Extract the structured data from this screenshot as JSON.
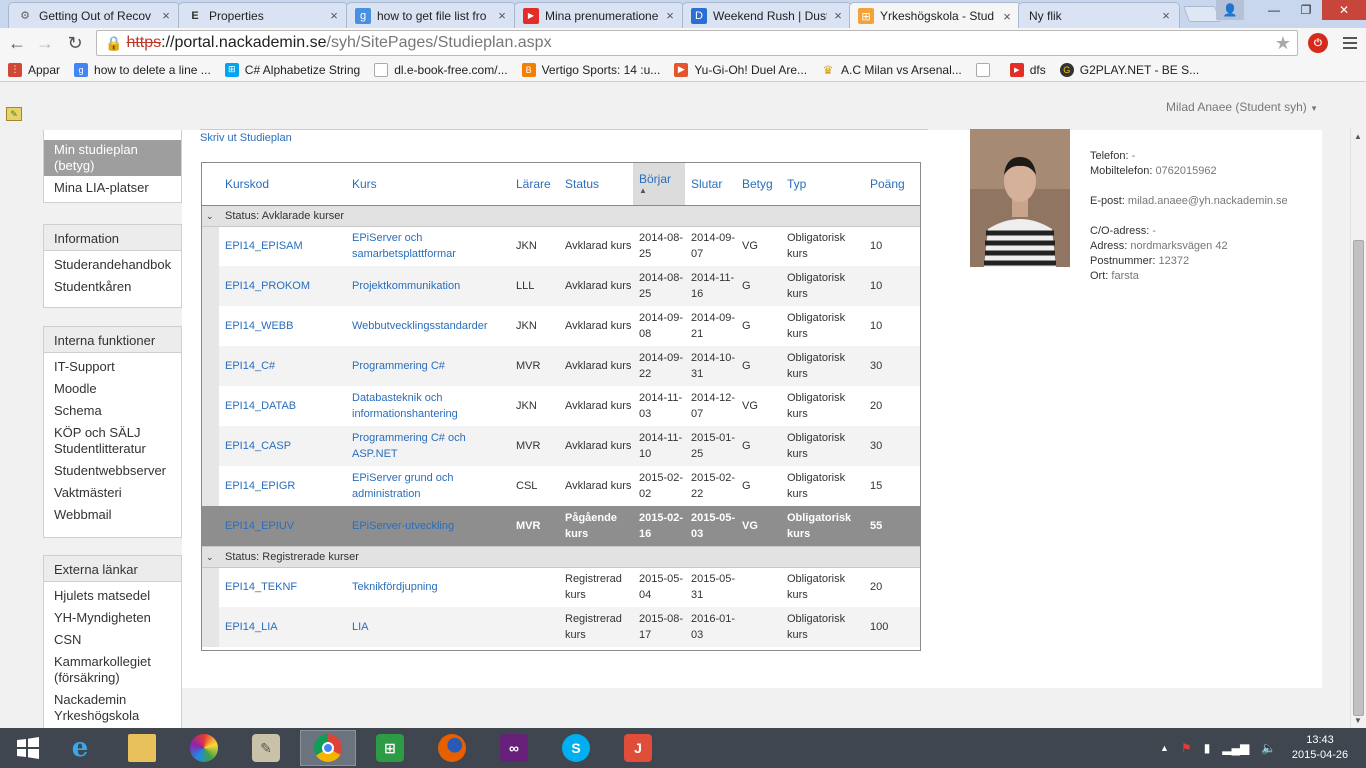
{
  "browser": {
    "tabs": [
      {
        "label": "Getting Out of Recov",
        "favicon": "gear-icon",
        "active": false
      },
      {
        "label": "Properties",
        "favicon": "edge-e-icon",
        "active": false
      },
      {
        "label": "how to get file list fro",
        "favicon": "google-icon",
        "active": false
      },
      {
        "label": "Mina prenumerationer",
        "favicon": "youtube-icon",
        "active": false
      },
      {
        "label": "Weekend Rush | Dust",
        "favicon": "dust-d-icon",
        "active": false
      },
      {
        "label": "Yrkeshögskola - Stud",
        "favicon": "yh-icon",
        "active": true
      },
      {
        "label": "Ny flik",
        "favicon": "",
        "active": false
      }
    ],
    "url": {
      "scheme": "https",
      "host": "://portal.nackademin.se",
      "path": "/syh/SitePages/Studieplan.aspx"
    },
    "bookmarks": [
      {
        "label": "Appar",
        "icon": "apps-icon",
        "color": "#d14836"
      },
      {
        "label": "how to delete a line ...",
        "icon": "google-icon",
        "color": "#4285f4"
      },
      {
        "label": "C# Alphabetize String",
        "icon": "windows-icon",
        "color": "#00a4ef"
      },
      {
        "label": "dl.e-book-free.com/...",
        "icon": "page-icon",
        "color": "#aaaaaa"
      },
      {
        "label": "Vertigo Sports: 14 :u...",
        "icon": "blogger-icon",
        "color": "#f57d00"
      },
      {
        "label": "Yu-Gi-Oh! Duel Are...",
        "icon": "play-icon",
        "color": "#e5552c"
      },
      {
        "label": "A.C Milan vs Arsenal...",
        "icon": "trophy-icon",
        "color": "#d4a20f"
      },
      {
        "label": "dfs",
        "icon": "youtube-icon",
        "color": "#e52d27"
      },
      {
        "label": "G2PLAY.NET - BE S...",
        "icon": "g2play-icon",
        "color": "#333333"
      }
    ]
  },
  "page": {
    "user_menu": "Milad Anaee (Student syh)",
    "print_link": "Skriv ut Studieplan"
  },
  "sidebar": {
    "top_items": [
      "Min studieplan (betyg)",
      "Mina LIA-platser"
    ],
    "sections": [
      {
        "title": "Information",
        "items": [
          "Studerandehandbok",
          "Studentkåren"
        ]
      },
      {
        "title": "Interna funktioner",
        "items": [
          "IT-Support",
          "Moodle",
          "Schema",
          "KÖP och SÄLJ Studentlitteratur",
          "Studentwebbserver",
          "Vaktmästeri",
          "Webbmail"
        ]
      },
      {
        "title": "Externa länkar",
        "items": [
          "Hjulets matsedel",
          "YH-Myndigheten",
          "CSN",
          "Kammarkollegiet (försäkring)",
          "Nackademin Yrkeshögskola"
        ]
      }
    ]
  },
  "table": {
    "headers": [
      "Kurskod",
      "Kurs",
      "Lärare",
      "Status",
      "Börjar",
      "Slutar",
      "Betyg",
      "Typ",
      "Poäng"
    ],
    "sort_indicator": "▲",
    "groups": [
      {
        "label": "Status: Avklarade kurser",
        "rows": [
          {
            "code": "EPI14_EPISAM",
            "course": "EPiServer och samarbetsplattformar",
            "teacher": "JKN",
            "status": "Avklarad kurs",
            "start": "2014-08-25",
            "end": "2014-09-07",
            "grade": "VG",
            "type": "Obligatorisk kurs",
            "points": "10"
          },
          {
            "code": "EPI14_PROKOM",
            "course": "Projektkommunikation",
            "teacher": "LLL",
            "status": "Avklarad kurs",
            "start": "2014-08-25",
            "end": "2014-11-16",
            "grade": "G",
            "type": "Obligatorisk kurs",
            "points": "10"
          },
          {
            "code": "EPI14_WEBB",
            "course": "Webbutvecklingsstandarder",
            "teacher": "JKN",
            "status": "Avklarad kurs",
            "start": "2014-09-08",
            "end": "2014-09-21",
            "grade": "G",
            "type": "Obligatorisk kurs",
            "points": "10"
          },
          {
            "code": "EPI14_C#",
            "course": "Programmering C#",
            "teacher": "MVR",
            "status": "Avklarad kurs",
            "start": "2014-09-22",
            "end": "2014-10-31",
            "grade": "G",
            "type": "Obligatorisk kurs",
            "points": "30"
          },
          {
            "code": "EPI14_DATAB",
            "course": "Databasteknik och informationshantering",
            "teacher": "JKN",
            "status": "Avklarad kurs",
            "start": "2014-11-03",
            "end": "2014-12-07",
            "grade": "VG",
            "type": "Obligatorisk kurs",
            "points": "20"
          },
          {
            "code": "EPI14_CASP",
            "course": "Programmering C# och ASP.NET",
            "teacher": "MVR",
            "status": "Avklarad kurs",
            "start": "2014-11-10",
            "end": "2015-01-25",
            "grade": "G",
            "type": "Obligatorisk kurs",
            "points": "30"
          },
          {
            "code": "EPI14_EPIGR",
            "course": "EPiServer grund och administration",
            "teacher": "CSL",
            "status": "Avklarad kurs",
            "start": "2015-02-02",
            "end": "2015-02-22",
            "grade": "G",
            "type": "Obligatorisk kurs",
            "points": "15"
          },
          {
            "code": "EPI14_EPIUV",
            "course": "EPiServer-utveckling",
            "teacher": "MVR",
            "status": "Pågående kurs",
            "start": "2015-02-16",
            "end": "2015-05-03",
            "grade": "VG",
            "type": "Obligatorisk kurs",
            "points": "55"
          }
        ]
      },
      {
        "label": "Status: Registrerade kurser",
        "rows": [
          {
            "code": "EPI14_TEKNF",
            "course": "Teknikfördjupning",
            "teacher": "",
            "status": "Registrerad kurs",
            "start": "2015-05-04",
            "end": "2015-05-31",
            "grade": "",
            "type": "Obligatorisk kurs",
            "points": "20"
          },
          {
            "code": "EPI14_LIA",
            "course": "LIA",
            "teacher": "",
            "status": "Registrerad kurs",
            "start": "2015-08-17",
            "end": "2016-01-03",
            "grade": "",
            "type": "Obligatorisk kurs",
            "points": "100"
          }
        ]
      }
    ]
  },
  "profile": {
    "phone_label": "Telefon:",
    "phone": "-",
    "mobile_label": "Mobiltelefon:",
    "mobile": "0762015962",
    "email_label": "E-post:",
    "email": "milad.anaee@yh.nackademin.se",
    "co_label": "C/O-adress:",
    "co": "-",
    "address_label": "Adress:",
    "address": "nordmarksvägen 42",
    "zip_label": "Postnummer:",
    "zip": "12372",
    "city_label": "Ort:",
    "city": "farsta"
  },
  "taskbar": {
    "apps": [
      "windows-start-icon",
      "internet-explorer-icon",
      "file-explorer-icon",
      "picasa-icon",
      "notepad-icon",
      "chrome-icon",
      "office-icon",
      "firefox-icon",
      "visual-studio-icon",
      "skype-icon",
      "yh-app-icon"
    ],
    "time": "13:43",
    "date": "2015-04-26"
  }
}
